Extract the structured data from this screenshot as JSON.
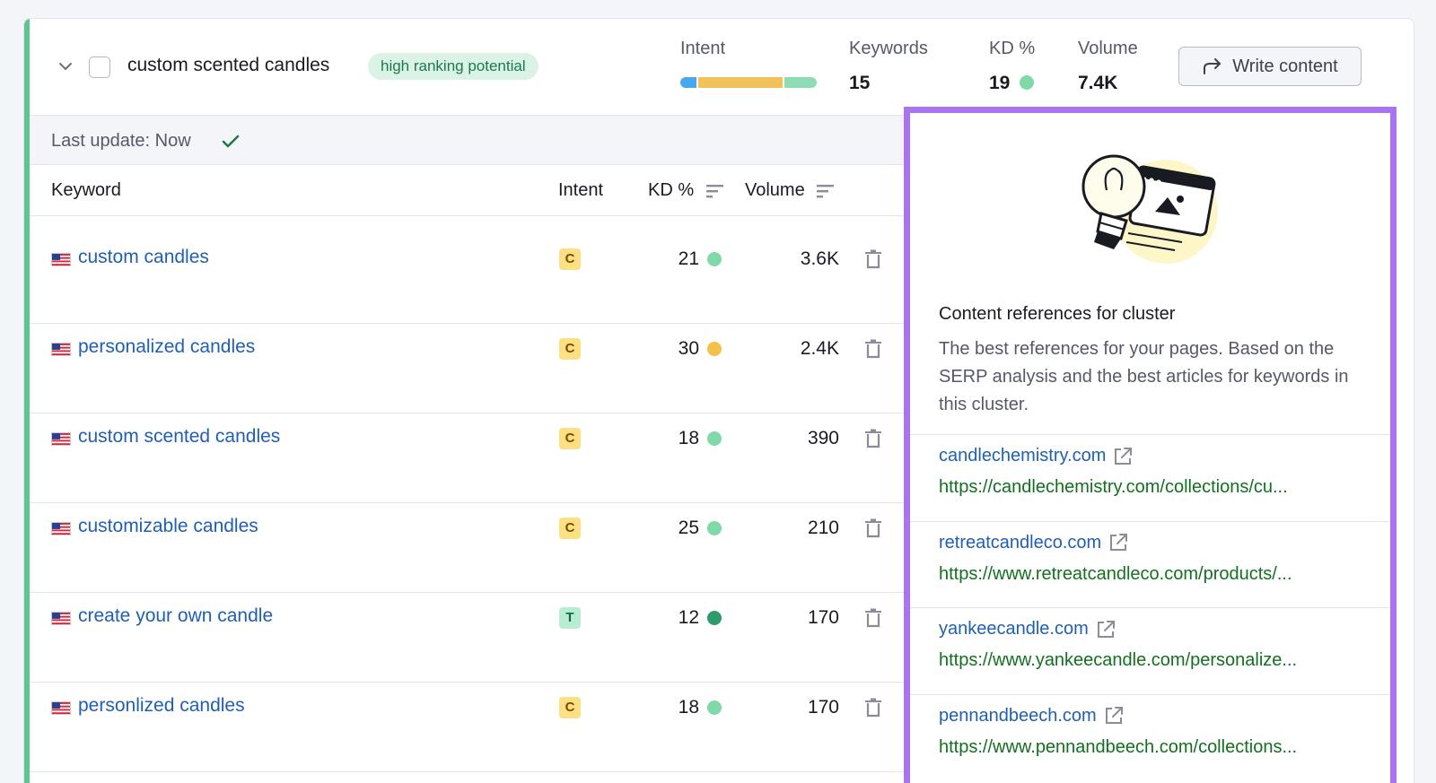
{
  "cluster": {
    "name": "custom scented candles",
    "badge": "high ranking potential",
    "metrics": {
      "intent_label": "Intent",
      "intent_mix": [
        {
          "share": 0.12,
          "color": "#4aa7ee"
        },
        {
          "share": 0.64,
          "color": "#f3c15a"
        },
        {
          "share": 0.24,
          "color": "#8fdcb4"
        }
      ],
      "keywords_label": "Keywords",
      "keywords_value": "15",
      "kd_label": "KD %",
      "kd_value": "19",
      "kd_color": "#7fd9a8",
      "volume_label": "Volume",
      "volume_value": "7.4K"
    },
    "write_button": "Write content"
  },
  "update": {
    "text": "Last update: Now"
  },
  "table": {
    "headers": {
      "keyword": "Keyword",
      "intent": "Intent",
      "kd": "KD %",
      "volume": "Volume"
    },
    "rows": [
      {
        "keyword": "custom candles",
        "intent": "C",
        "kd": "21",
        "kd_color": "#7fd9a8",
        "volume": "3.6K"
      },
      {
        "keyword": "personalized candles",
        "intent": "C",
        "kd": "30",
        "kd_color": "#f5c04a",
        "volume": "2.4K"
      },
      {
        "keyword": "custom scented candles",
        "intent": "C",
        "kd": "18",
        "kd_color": "#7fd9a8",
        "volume": "390"
      },
      {
        "keyword": "customizable candles",
        "intent": "C",
        "kd": "25",
        "kd_color": "#7fd9a8",
        "volume": "210"
      },
      {
        "keyword": "create your own candle",
        "intent": "T",
        "kd": "12",
        "kd_color": "#2f9a6a",
        "volume": "170"
      },
      {
        "keyword": "personlized candles",
        "intent": "C",
        "kd": "18",
        "kd_color": "#7fd9a8",
        "volume": "170"
      }
    ]
  },
  "references": {
    "title": "Content references for cluster",
    "description": "The best references for your pages. Based on the SERP analysis and the best articles for keywords in this cluster.",
    "items": [
      {
        "domain": "candlechemistry.com",
        "url": "https://candlechemistry.com/collections/cu..."
      },
      {
        "domain": "retreatcandleco.com",
        "url": "https://www.retreatcandleco.com/products/..."
      },
      {
        "domain": "yankeecandle.com",
        "url": "https://www.yankeecandle.com/personalize..."
      },
      {
        "domain": "pennandbeech.com",
        "url": "https://www.pennandbeech.com/collections..."
      }
    ]
  },
  "accent_colors": {
    "cluster_stripe": "#5fc58e",
    "panel_highlight": "#a973f2",
    "link": "#1f5fb4",
    "url": "#13701f"
  }
}
